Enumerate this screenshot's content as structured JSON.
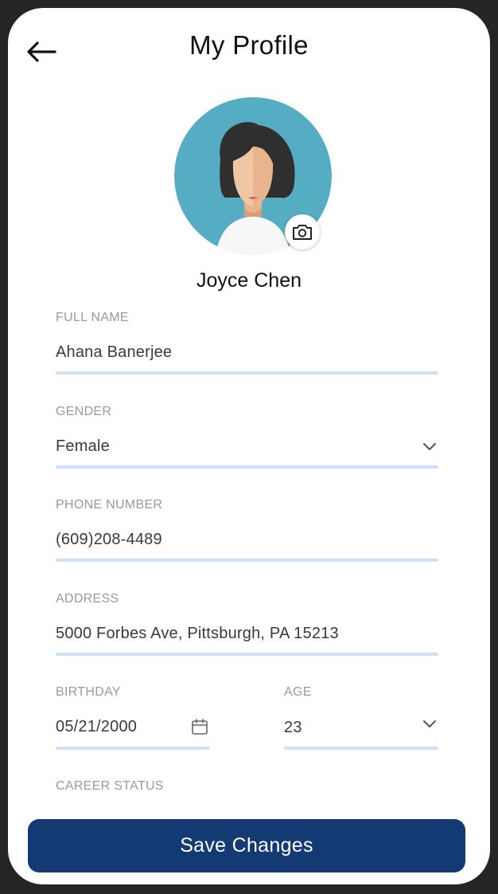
{
  "header": {
    "title": "My Profile",
    "back_icon": "arrow-left-icon"
  },
  "profile": {
    "name": "Joyce Chen",
    "avatar_icon": "avatar-woman-icon",
    "camera_icon": "camera-icon",
    "avatar_bg": "#55adc4"
  },
  "fields": {
    "full_name": {
      "label": "FULL NAME",
      "value": "Ahana Banerjee"
    },
    "gender": {
      "label": "GENDER",
      "value": "Female"
    },
    "phone": {
      "label": "PHONE NUMBER",
      "value": "(609)208-4489"
    },
    "address": {
      "label": "ADDRESS",
      "value": "5000 Forbes Ave, Pittsburgh, PA 15213"
    },
    "birthday": {
      "label": "BIRTHDAY",
      "value": "05/21/2000"
    },
    "age": {
      "label": "AGE",
      "value": "23"
    },
    "career_status": {
      "label": "CAREER STATUS"
    }
  },
  "actions": {
    "save_label": "Save Changes"
  },
  "colors": {
    "accent": "#143a73",
    "underline": "#cfe0fb",
    "label": "#9a9a9a"
  }
}
